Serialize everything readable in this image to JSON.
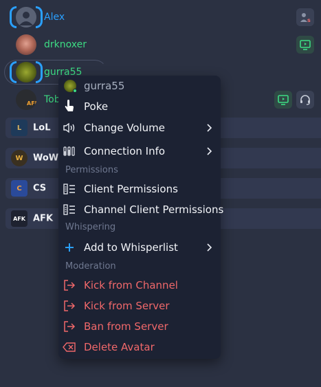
{
  "users": [
    {
      "name": "Alex",
      "color": "#2aa0ff"
    },
    {
      "name": "drknoxer",
      "color": "#3ddc84"
    },
    {
      "name": "gurra55",
      "color": "#3ddc84"
    },
    {
      "name": "Tob",
      "color": "#3ddc84",
      "avatar_text": "AFK"
    }
  ],
  "channels": [
    {
      "name": "LoL",
      "icon": "L"
    },
    {
      "name": "WoW",
      "icon": "W"
    },
    {
      "name": "CS",
      "icon": "C"
    },
    {
      "name": "AFK",
      "icon": "AFK"
    }
  ],
  "context_menu": {
    "header_user": "gurra55",
    "poke": "Poke",
    "change_volume": "Change Volume",
    "connection_info": "Connection Info",
    "section_permissions": "Permissions",
    "client_permissions": "Client Permissions",
    "channel_client_permissions": "Channel Client Permissions",
    "section_whispering": "Whispering",
    "add_to_whisperlist": "Add to Whisperlist",
    "section_moderation": "Moderation",
    "kick_from_channel": "Kick from Channel",
    "kick_from_server": "Kick from Server",
    "ban_from_server": "Ban from Server",
    "delete_avatar": "Delete Avatar"
  },
  "colors": {
    "background": "#2b3142",
    "menu_bg": "#1c2233",
    "accent_blue": "#2aa0ff",
    "online_green": "#3ddc84",
    "danger_red": "#f0686a"
  }
}
